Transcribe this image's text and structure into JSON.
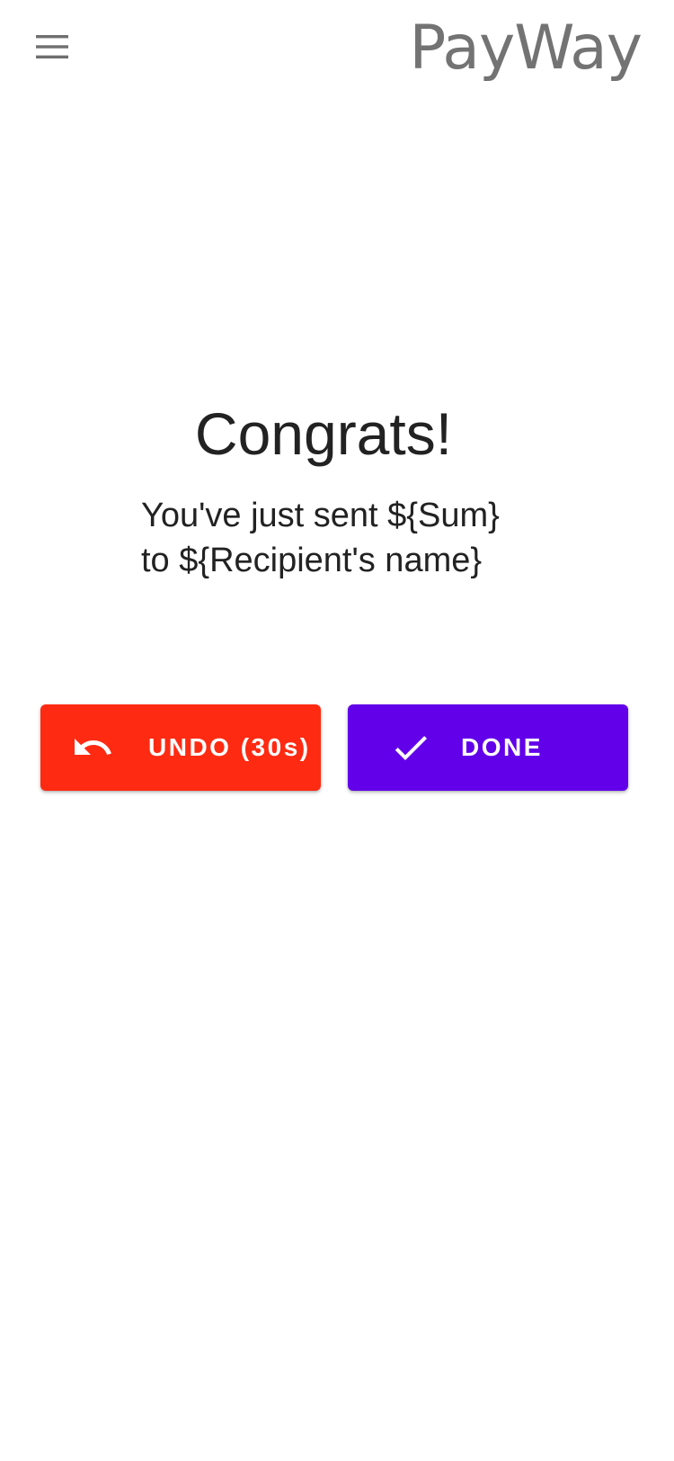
{
  "app_bar": {
    "menu_icon": "hamburger-menu-icon",
    "title": "PayWay"
  },
  "confirmation": {
    "headline": "Congrats!",
    "message_line1": "You've just sent ${Sum}",
    "message_line2": "to ${Recipient's name}"
  },
  "actions": {
    "undo": {
      "label": "UNDO (30s)",
      "icon": "undo-arrow-icon",
      "color": "#ff2a12"
    },
    "done": {
      "label": "DONE",
      "icon": "checkmark-icon",
      "color": "#6200ea"
    }
  },
  "colors": {
    "background": "#ffffff",
    "title_gray": "#737373",
    "text_dark": "#222222"
  }
}
